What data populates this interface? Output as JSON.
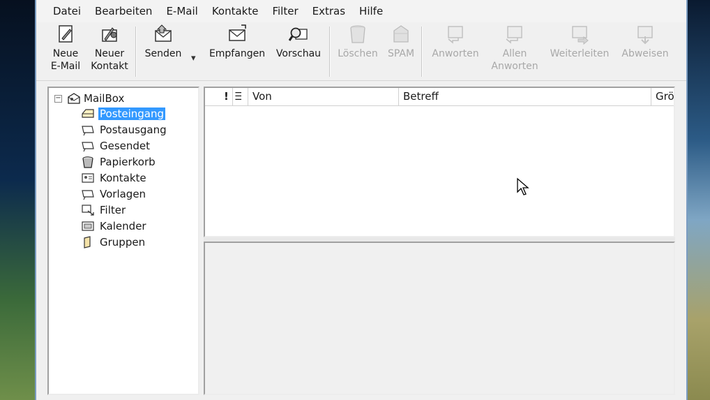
{
  "menubar": {
    "items": [
      {
        "label": "Datei"
      },
      {
        "label": "Bearbeiten"
      },
      {
        "label": "E-Mail"
      },
      {
        "label": "Kontakte"
      },
      {
        "label": "Filter"
      },
      {
        "label": "Extras"
      },
      {
        "label": "Hilfe"
      }
    ]
  },
  "toolbar": {
    "new_mail": {
      "line1": "Neue",
      "line2": "E-Mail"
    },
    "new_contact": {
      "line1": "Neuer",
      "line2": "Kontakt"
    },
    "send": {
      "label": "Senden",
      "arrow": "▾"
    },
    "receive": {
      "label": "Empfangen"
    },
    "preview": {
      "label": "Vorschau"
    },
    "delete": {
      "label": "Löschen"
    },
    "spam": {
      "label": "SPAM"
    },
    "reply": {
      "label": "Anworten"
    },
    "reply_all": {
      "line1": "Allen",
      "line2": "Anworten"
    },
    "forward": {
      "label": "Weiterleiten"
    },
    "reject": {
      "label": "Abweisen"
    }
  },
  "tree": {
    "root": {
      "label": "MailBox",
      "expander": "−"
    },
    "items": [
      {
        "label": "Posteingang",
        "icon": "inbox-icon",
        "selected": true
      },
      {
        "label": "Postausgang",
        "icon": "outbox-icon"
      },
      {
        "label": "Gesendet",
        "icon": "sent-icon"
      },
      {
        "label": "Papierkorb",
        "icon": "trash-icon"
      },
      {
        "label": "Kontakte",
        "icon": "contacts-icon"
      },
      {
        "label": "Vorlagen",
        "icon": "templates-icon"
      },
      {
        "label": "Filter",
        "icon": "filter-icon"
      },
      {
        "label": "Kalender",
        "icon": "calendar-icon"
      },
      {
        "label": "Gruppen",
        "icon": "groups-icon"
      }
    ]
  },
  "message_list": {
    "columns": {
      "priority": "!",
      "attachment": "Ⲷ",
      "from": "Von",
      "subject": "Betreff",
      "size": "Grö"
    }
  },
  "colors": {
    "selection": "#3399ff",
    "disabled_text": "#a8a8a8"
  }
}
